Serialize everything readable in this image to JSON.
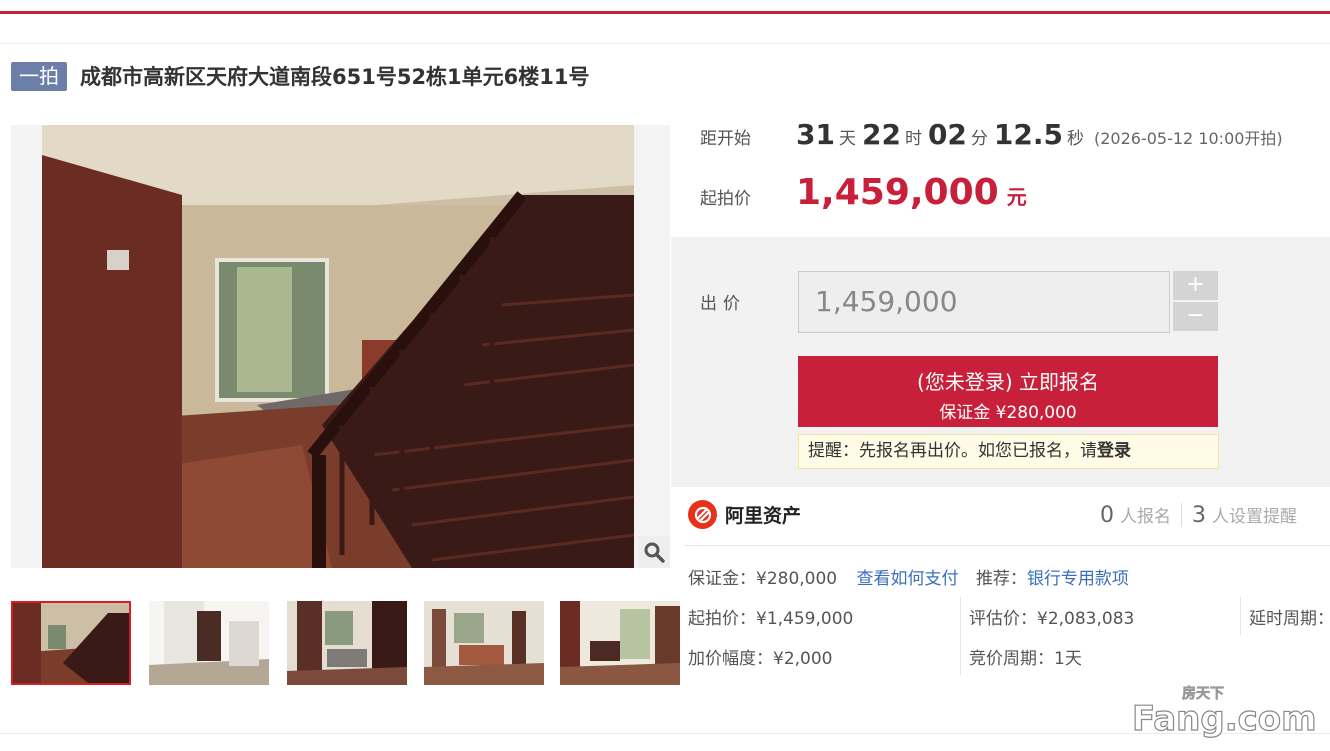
{
  "header": {
    "tag": "一拍",
    "title": "成都市高新区天府大道南段651号52栋1单元6楼11号"
  },
  "gallery": {
    "thumbnail_count": 5,
    "active_index": 0,
    "zoom_icon": "magnifier-icon"
  },
  "countdown": {
    "label": "距开始",
    "days": "31",
    "days_unit": "天",
    "hours": "22",
    "hours_unit": "时",
    "minutes": "02",
    "minutes_unit": "分",
    "seconds": "12.5",
    "seconds_unit": "秒",
    "start_note": "(2026-05-12 10:00开拍)"
  },
  "starting_price": {
    "label": "起拍价",
    "value": "1,459,000",
    "unit": "元"
  },
  "bid": {
    "label": "出价",
    "placeholder": "1,459,000",
    "plus": "+",
    "minus": "−"
  },
  "signup": {
    "main": "(您未登录) 立即报名",
    "sub": "保证金 ¥280,000"
  },
  "reminder": {
    "text": "提醒：先报名再出价。如您已报名，请",
    "link": "登录"
  },
  "brand": {
    "name": "阿里资产",
    "logo_icon": "ali-assets-logo-icon"
  },
  "stats": {
    "signups_count": "0",
    "signups_label": "人报名",
    "reminders_count": "3",
    "reminders_label": "人设置提醒"
  },
  "details": {
    "deposit": "保证金：¥280,000",
    "how_to_pay": "查看如何支付",
    "recommend_label": "推荐：",
    "recommend_link": "银行专用款项",
    "start_price": "起拍价：¥1,459,000",
    "appraisal": "评估价：¥2,083,083",
    "delay_period": "延时周期：",
    "increment": "加价幅度：¥2,000",
    "bid_period": "竞价周期：1天"
  },
  "watermark": {
    "cn": "房天下",
    "en": "Fang.com"
  },
  "colors": {
    "accent": "#c8203a",
    "tag_bg": "#6b7fa8",
    "link": "#3a6fc0"
  }
}
